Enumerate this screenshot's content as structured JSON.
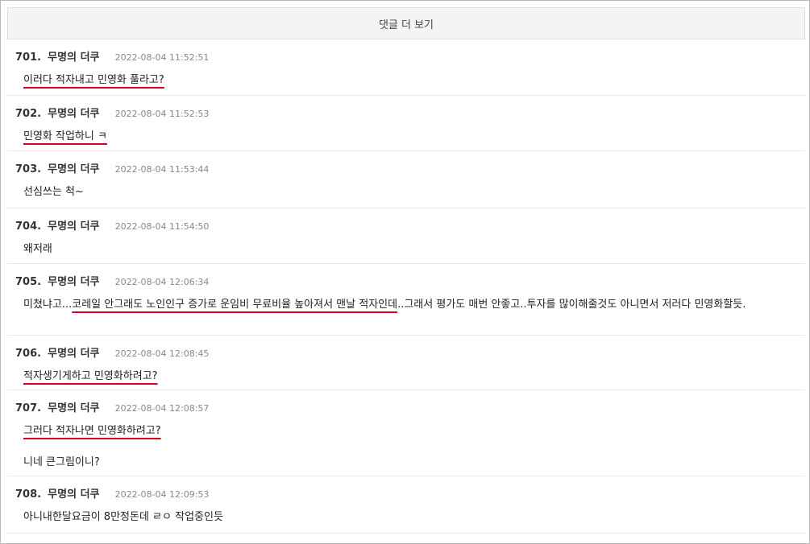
{
  "more_button": {
    "label": "댓글 더 보기"
  },
  "comments": [
    {
      "number": "701.",
      "author": "무명의 더쿠",
      "date": "2022-08-04 11:52:51",
      "paragraphs": [
        [
          {
            "text": "이러다 적자내고 민영화 풀라고?",
            "hl": true
          }
        ]
      ]
    },
    {
      "number": "702.",
      "author": "무명의 더쿠",
      "date": "2022-08-04 11:52:53",
      "paragraphs": [
        [
          {
            "text": "민영화 작업하니 ㅋ",
            "hl": true
          }
        ]
      ]
    },
    {
      "number": "703.",
      "author": "무명의 더쿠",
      "date": "2022-08-04 11:53:44",
      "paragraphs": [
        [
          {
            "text": "선심쓰는 척~",
            "hl": false
          }
        ]
      ]
    },
    {
      "number": "704.",
      "author": "무명의 더쿠",
      "date": "2022-08-04 11:54:50",
      "paragraphs": [
        [
          {
            "text": "왜저래",
            "hl": false
          }
        ]
      ]
    },
    {
      "number": "705.",
      "author": "무명의 더쿠",
      "date": "2022-08-04 12:06:34",
      "paragraphs": [
        [
          {
            "text": "미쳤냐고...",
            "hl": false
          },
          {
            "text": "코레일 안그래도 노인인구 증가로 운임비 무료비율 높아져서 맨날 적자인데",
            "hl": true
          },
          {
            "text": "..그래서 평가도 매번 안좋고..투자를 많이해줄것도 아니면서 저러다 민영화할듯.",
            "hl": false
          }
        ]
      ]
    },
    {
      "number": "706.",
      "author": "무명의 더쿠",
      "date": "2022-08-04 12:08:45",
      "paragraphs": [
        [
          {
            "text": "적자생기게하고 민영화하려고?",
            "hl": true
          }
        ]
      ]
    },
    {
      "number": "707.",
      "author": "무명의 더쿠",
      "date": "2022-08-04 12:08:57",
      "paragraphs": [
        [
          {
            "text": "그러다 적자나면 민영화하려고?",
            "hl": true
          }
        ],
        [
          {
            "text": "니네 큰그림이니?",
            "hl": false
          }
        ]
      ]
    },
    {
      "number": "708.",
      "author": "무명의 더쿠",
      "date": "2022-08-04 12:09:53",
      "paragraphs": [
        [
          {
            "text": "아니내한달요금이 8만정돈데 ㄹㅇ 작업중인듯",
            "hl": false
          }
        ]
      ]
    }
  ],
  "colors": {
    "highlight_underline": "#d6001c",
    "date_text": "#888888"
  }
}
